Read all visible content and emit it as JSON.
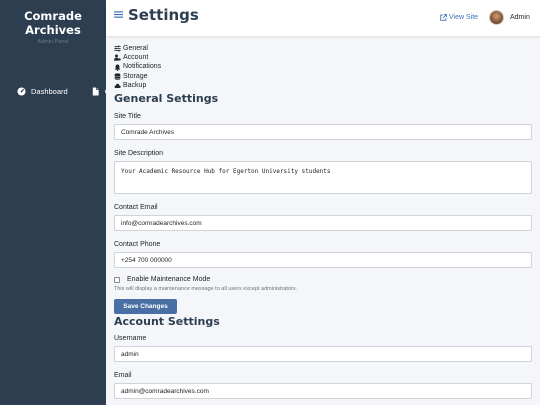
{
  "sidebar": {
    "brand": "Comrade Archives",
    "subtitle": "Admin Panel",
    "items": [
      {
        "label": "Dashboard",
        "icon": "gauge-icon"
      },
      {
        "label": "",
        "icon": "file-icon"
      },
      {
        "label": "C",
        "icon": ""
      }
    ]
  },
  "header": {
    "title": "Settings",
    "view_site": "View Site",
    "user": "Admin"
  },
  "subnav": [
    {
      "label": "General",
      "icon": "sliders-icon"
    },
    {
      "label": "Account",
      "icon": "user-gear-icon"
    },
    {
      "label": "Notifications",
      "icon": "bell-icon"
    },
    {
      "label": "Storage",
      "icon": "database-icon"
    },
    {
      "label": "Backup",
      "icon": "cloud-icon"
    }
  ],
  "general": {
    "heading": "General Settings",
    "site_title_label": "Site Title",
    "site_title_value": "Comrade Archives",
    "site_description_label": "Site Description",
    "site_description_value": "Your Academic Resource Hub for Egerton University students",
    "contact_email_label": "Contact Email",
    "contact_email_value": "info@comradearchives.com",
    "contact_phone_label": "Contact Phone",
    "contact_phone_value": "+254 700 000000",
    "maintenance_label": "Enable Maintenance Mode",
    "maintenance_checked": false,
    "maintenance_help": "This will display a maintenance message to all users except administrators.",
    "save_label": "Save Changes"
  },
  "account": {
    "heading": "Account Settings",
    "username_label": "Username",
    "username_value": "admin",
    "email_label": "Email",
    "email_value": "admin@comradearchives.com"
  },
  "colors": {
    "sidebar_bg": "#2c3e50",
    "accent": "#4a6fa5",
    "link": "#3d6fb6"
  }
}
